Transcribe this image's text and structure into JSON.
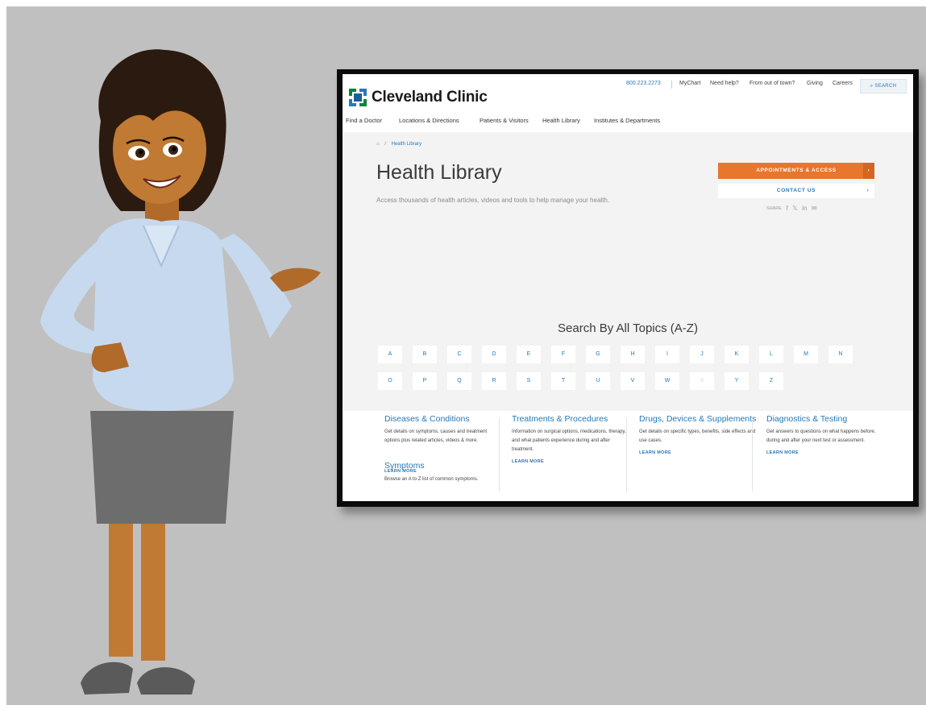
{
  "header": {
    "brand_name": "Cleveland Clinic",
    "phone": "800.223.2273",
    "util_links": [
      "MyChart",
      "Need help?",
      "From out of town?",
      "Giving",
      "Careers"
    ],
    "search_label": "SEARCH",
    "main_nav": [
      "Find a Doctor",
      "Locations & Directions",
      "Patients & Visitors",
      "Health Library",
      "Institutes & Departments"
    ]
  },
  "breadcrumb": {
    "home_icon": "home-icon",
    "separator": "/",
    "current": "Health Library"
  },
  "hero": {
    "title": "Health Library",
    "subtitle": "Access thousands of health articles, videos and tools to help manage your health.",
    "appointments_label": "APPOINTMENTS & ACCESS",
    "contact_label": "CONTACT US",
    "arrow_glyph": "›",
    "share_label": "SHARE",
    "share_icons": [
      "facebook-icon",
      "twitter-icon",
      "linkedin-icon",
      "email-icon"
    ]
  },
  "az": {
    "heading": "Search By All Topics (A-Z)",
    "row1": [
      "A",
      "B",
      "C",
      "D",
      "E",
      "F",
      "G",
      "H",
      "I",
      "J",
      "K",
      "L",
      "M",
      "N"
    ],
    "row2": [
      "O",
      "P",
      "Q",
      "R",
      "S",
      "T",
      "U",
      "V",
      "W",
      "X",
      "Y",
      "Z"
    ],
    "disabled_letters": [
      "X"
    ]
  },
  "categories": [
    {
      "title": "Diseases & Conditions",
      "description": "Get details on symptoms, causes and treatment options plus related articles, videos & more."
    },
    {
      "title": "Treatments & Procedures",
      "description": "Information on surgical options, medications, therapy, and what patients experience during and after treatment.",
      "link": "LEARN MORE"
    },
    {
      "title": "Drugs, Devices & Supplements",
      "description": "Get details on specific types, benefits, side effects and use cases.",
      "link": "LEARN MORE"
    },
    {
      "title": "Diagnostics & Testing",
      "description": "Get answers to questions on what happens before, during and after your next test or assessment.",
      "link": "LEARN MORE"
    }
  ],
  "symptoms": {
    "title": "Symptoms",
    "link": "LEARN MORE",
    "description": "Browse an A to Z list of common symptoms."
  },
  "colors": {
    "brand_blue": "#2479bb",
    "brand_green": "#00843d",
    "accent_orange": "#e8762c",
    "hero_bg": "#f3f3f3",
    "backdrop_gray": "#c0c0c0"
  }
}
